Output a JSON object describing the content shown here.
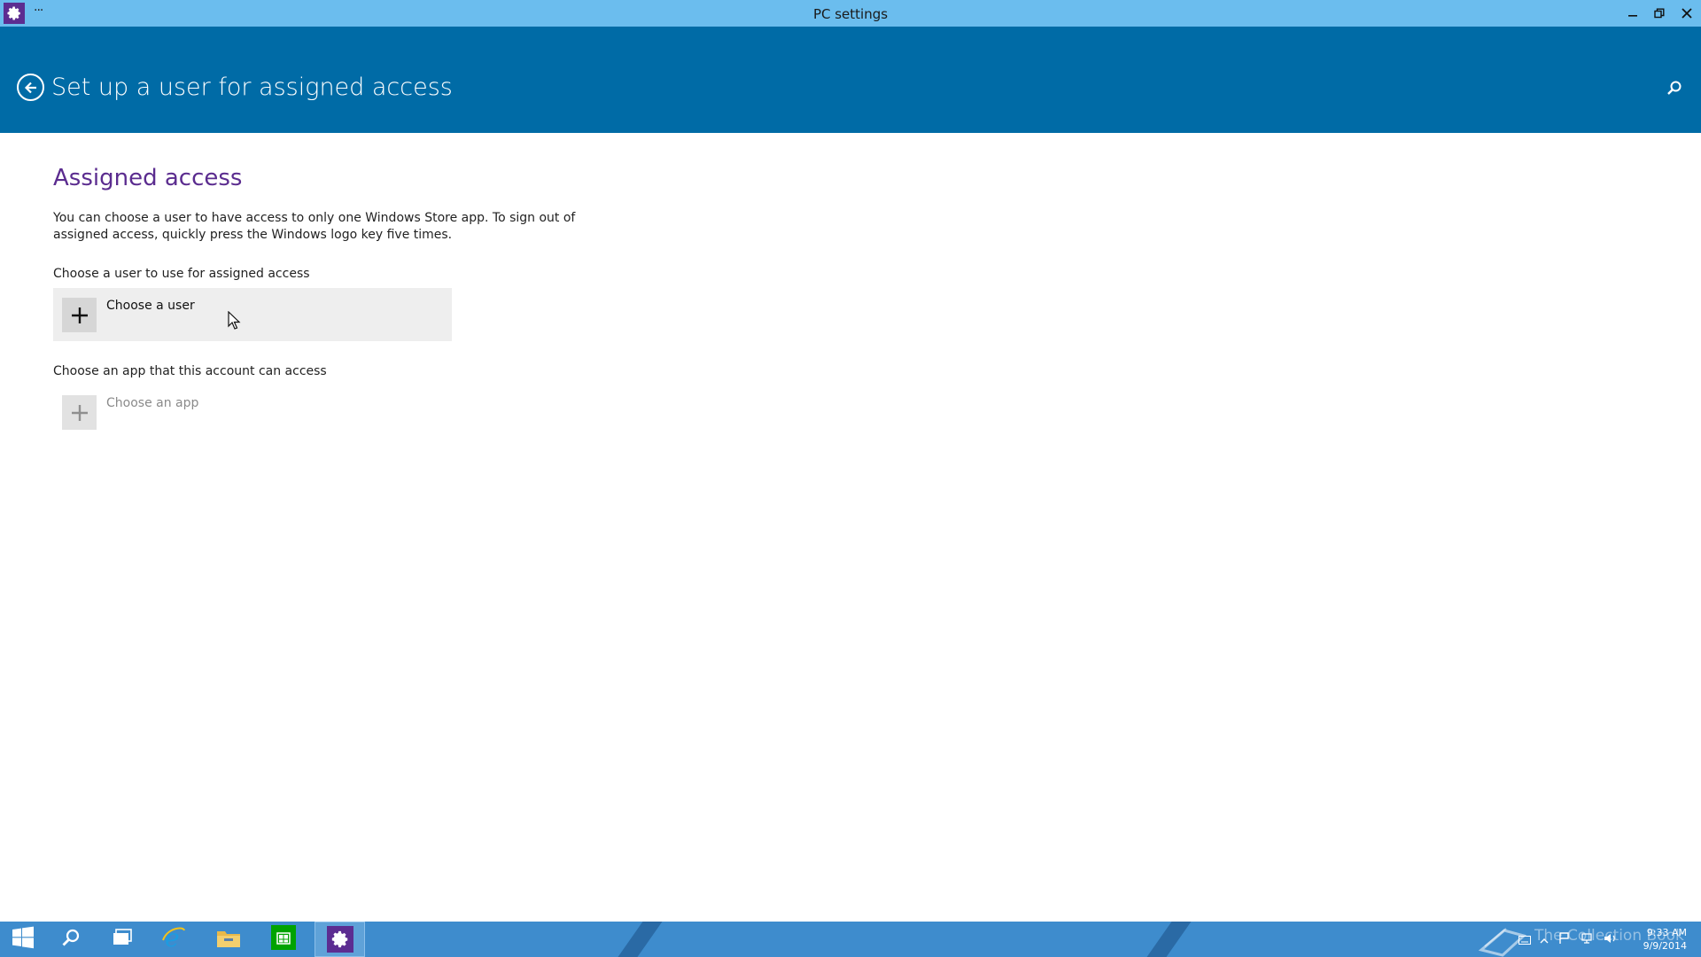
{
  "window": {
    "title": "PC settings",
    "menu_label": "···",
    "minimize_glyph": "—",
    "maximize_glyph": "❐",
    "close_glyph": "✕"
  },
  "header": {
    "page_title": "Set up a user for assigned access",
    "back_icon": "back-arrow-icon",
    "search_icon": "search-icon"
  },
  "main": {
    "section_title": "Assigned access",
    "description": "You can choose a user to have access to only one Windows Store app. To sign out of assigned access, quickly press the Windows logo key five times.",
    "user_section": {
      "label": "Choose a user to use for assigned access",
      "button_label": "Choose a user"
    },
    "app_section": {
      "label": "Choose an app that this account can access",
      "button_label": "Choose an app"
    }
  },
  "taskbar": {
    "items": [
      {
        "name": "start-button",
        "icon": "windows-logo-icon"
      },
      {
        "name": "search-button",
        "icon": "search-icon"
      },
      {
        "name": "task-view-button",
        "icon": "task-view-icon"
      },
      {
        "name": "internet-explorer-button",
        "icon": "internet-explorer-icon"
      },
      {
        "name": "file-explorer-button",
        "icon": "folder-icon"
      },
      {
        "name": "store-button",
        "icon": "store-icon"
      },
      {
        "name": "pc-settings-button",
        "icon": "gear-icon",
        "active": true
      }
    ],
    "watermark": "The Collection Book",
    "clock_time": "9:33 AM",
    "clock_date": "9/9/2014"
  },
  "colors": {
    "titlebar": "#6bbdee",
    "header": "#006ba6",
    "accent_purple": "#5b2c8f",
    "taskbar": "#3e8ccd"
  }
}
